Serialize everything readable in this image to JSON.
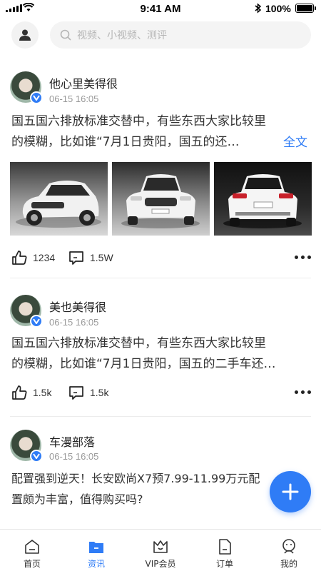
{
  "status_bar": {
    "time": "9:41 AM",
    "battery": "100%"
  },
  "header": {
    "search_placeholder": "视频、小视频、测评"
  },
  "feed": [
    {
      "author": "他心里美得很",
      "time": "06-15 16:05",
      "text_line1": "国五国六排放标准交替中，有些东西大家比较里",
      "text_line2": "的模糊，比如谁“7月1日贵阳，国五的还…",
      "full_text_label": "全文",
      "likes": "1234",
      "comments": "1.5W"
    },
    {
      "author": "美也美得很",
      "time": "06-15 16:05",
      "text_line1": "国五国六排放标准交替中，有些东西大家比较里",
      "text_line2": "的模糊，比如谁“7月1日贵阳，国五的二手车还…",
      "likes": "1.5k",
      "comments": "1.5k"
    },
    {
      "author": "车漫部落",
      "time": "06-15 16:05",
      "text_line1": "配置强到逆天！长安欧尚X7预7.99-11.99万元配",
      "text_line2": "置颇为丰富，值得购买吗?"
    }
  ],
  "tabs": [
    {
      "label": "首页",
      "icon": "home-icon"
    },
    {
      "label": "资讯",
      "icon": "news-icon",
      "active": true
    },
    {
      "label": "VIP会员",
      "icon": "vip-icon"
    },
    {
      "label": "订单",
      "icon": "order-icon"
    },
    {
      "label": "我的",
      "icon": "profile-icon"
    }
  ],
  "colors": {
    "accent": "#2f7cf6",
    "text": "#333333",
    "muted": "#999999"
  }
}
